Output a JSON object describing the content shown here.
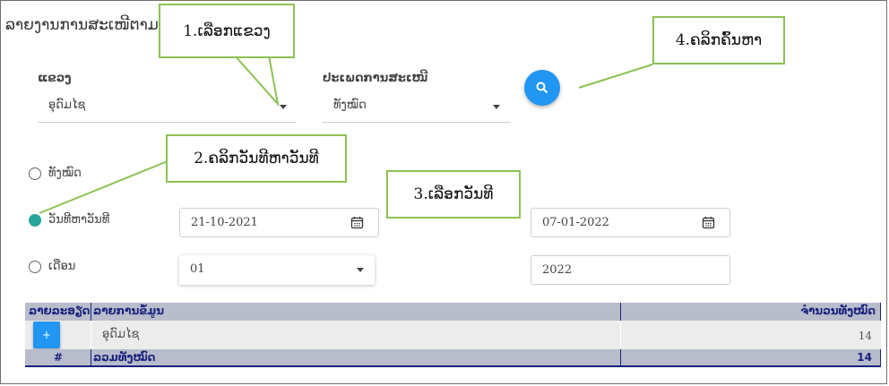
{
  "page": {
    "title": "ລາຍງານການສະເໜີຕາມ"
  },
  "filters": {
    "province": {
      "label": "ແຂວງ",
      "value": "ອຸດົມໄຊ"
    },
    "proposal_type": {
      "label": "ປະເພດການສະເໜີ",
      "value": "ທັງໝົດ"
    },
    "search_icon": "search-icon"
  },
  "date_mode": {
    "all_label": "ທັງໝົດ",
    "range_label": "ວັນທີຫາວັນທີ",
    "month_label": "ເດືອນ",
    "selected": "range",
    "accent_color": "#26a69a"
  },
  "dates": {
    "from": "21-10-2021",
    "to": "07-01-2022",
    "month": "01",
    "year": "2022",
    "calendar_icon": "calendar-icon"
  },
  "callouts": {
    "step1": "1.ເລືອກແຂວງ",
    "step2": "2.ຄລິກວັນທີຫາວັນທີ",
    "step3": "3.ເລືອກວັນທີ",
    "step4": "4.ຄລິກຄົ້ນຫາ",
    "border_color": "#8cc152"
  },
  "table": {
    "headers": {
      "detail": "ລາຍລະອຽດ",
      "item": "ລາຍການຂໍ້ມູນ",
      "total": "ຈໍານວນທັງໝົດ"
    },
    "rows": [
      {
        "expand": "+",
        "item": "ອຸດົມໄຊ",
        "total": "14"
      }
    ],
    "footer": {
      "number_sign": "#",
      "label": "ລວມທັງໝົດ",
      "total": "14"
    },
    "header_color": "#b8bccb",
    "text_color": "#1a237e"
  },
  "accent": "#2196f3"
}
